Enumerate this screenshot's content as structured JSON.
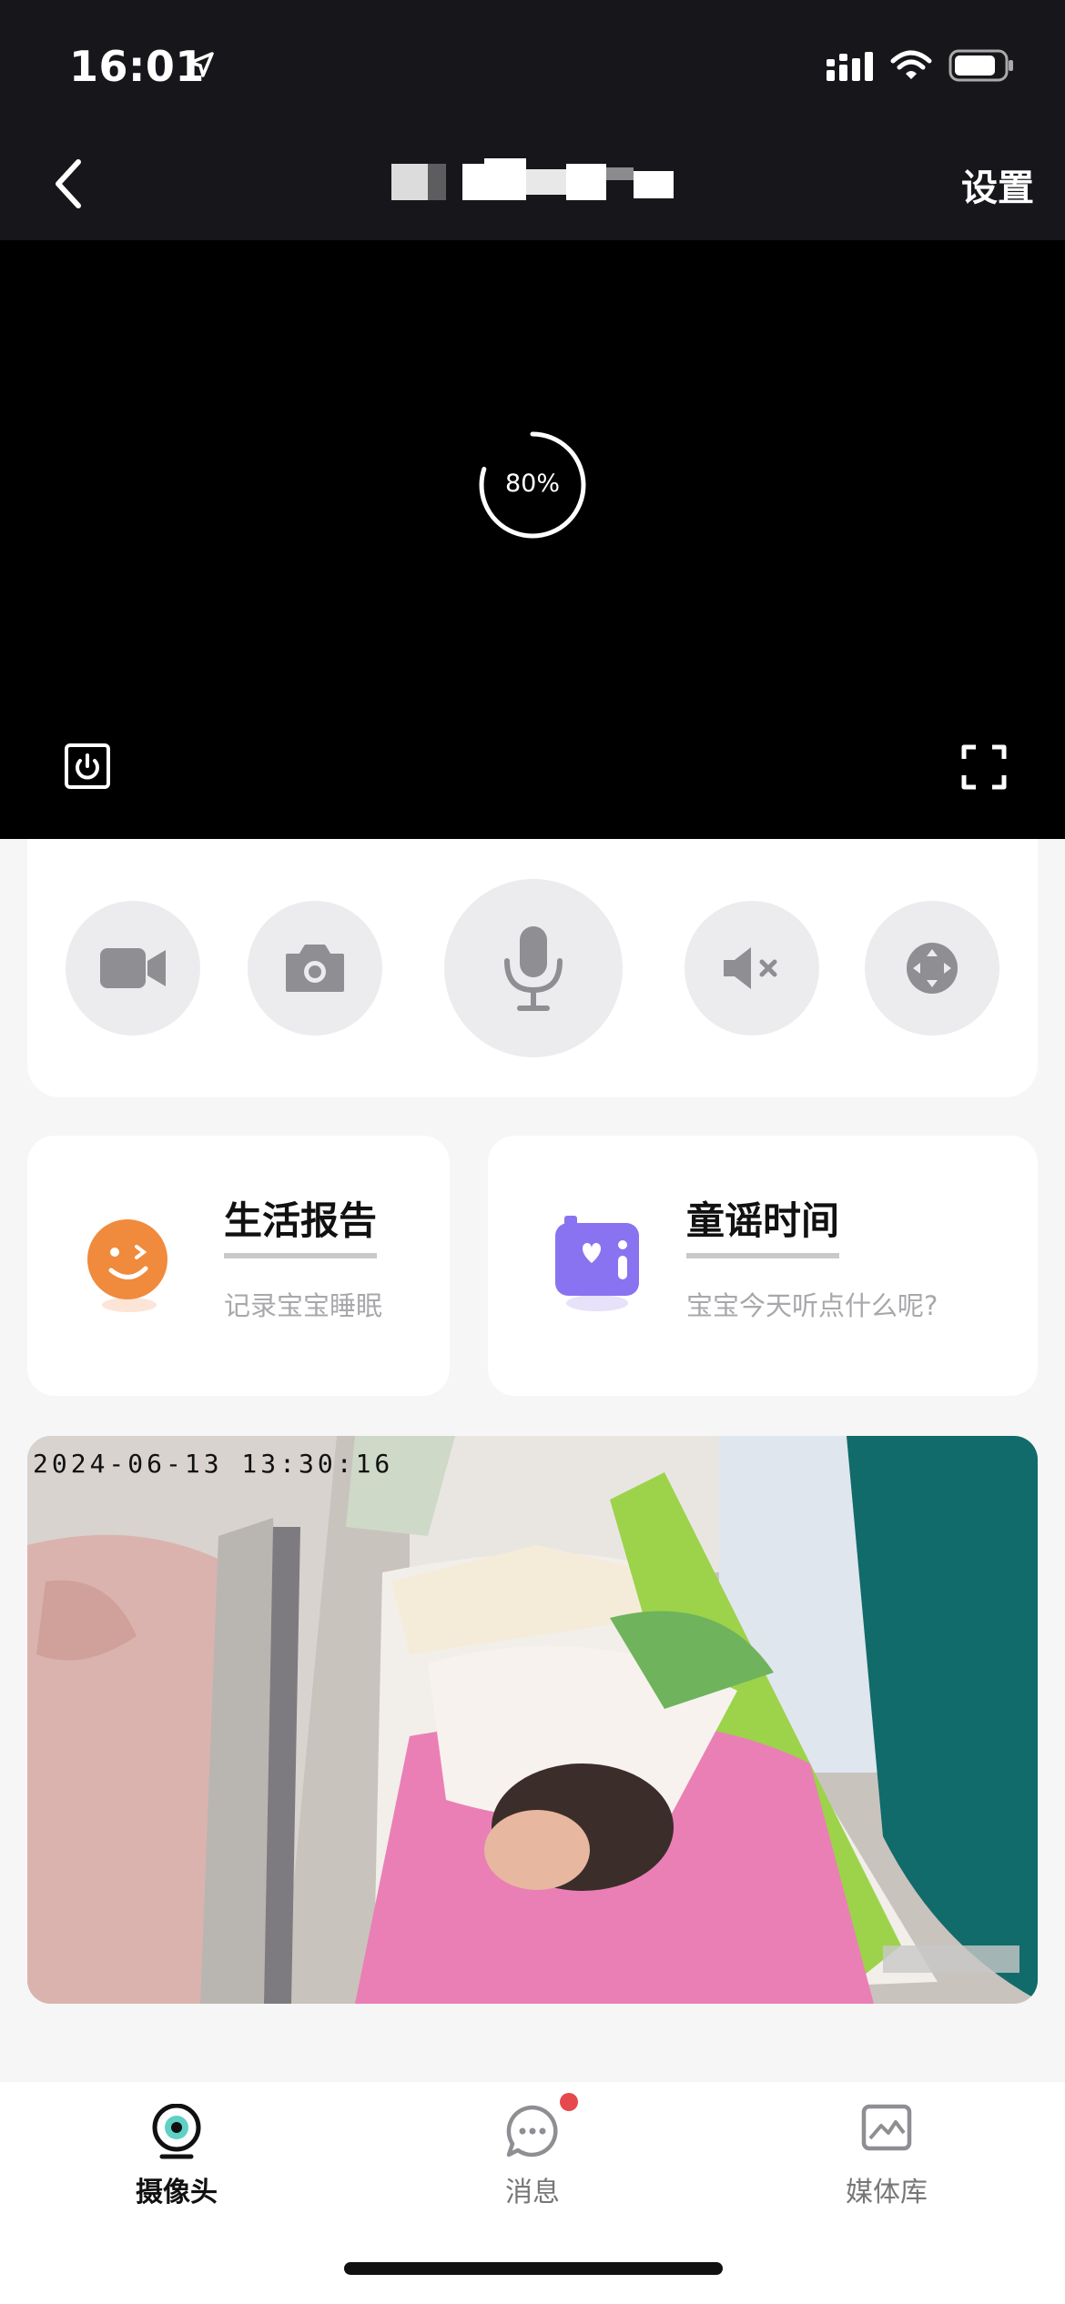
{
  "status_bar": {
    "time": "16:01"
  },
  "nav": {
    "settings_label": "设置"
  },
  "video": {
    "loading_percent": "80%",
    "loading_fraction": 0.8
  },
  "controls": {
    "items": [
      "record-button",
      "snapshot-button",
      "talk-button",
      "mute-button",
      "ptz-button"
    ]
  },
  "cards": [
    {
      "title": "生活报告",
      "subtitle": "记录宝宝睡眠"
    },
    {
      "title": "童谣时间",
      "subtitle": "宝宝今天听点什么呢?"
    }
  ],
  "snapshot": {
    "timestamp": "2024-06-13 13:30:16"
  },
  "tabs": [
    {
      "label": "摄像头",
      "active": true
    },
    {
      "label": "消息",
      "active": false,
      "has_badge": true
    },
    {
      "label": "媒体库",
      "active": false
    }
  ],
  "colors": {
    "bar_bg": "#17171b",
    "badge": "#e5484d",
    "report_icon": "#f08a3c",
    "songs_icon": "#8a73f0"
  }
}
